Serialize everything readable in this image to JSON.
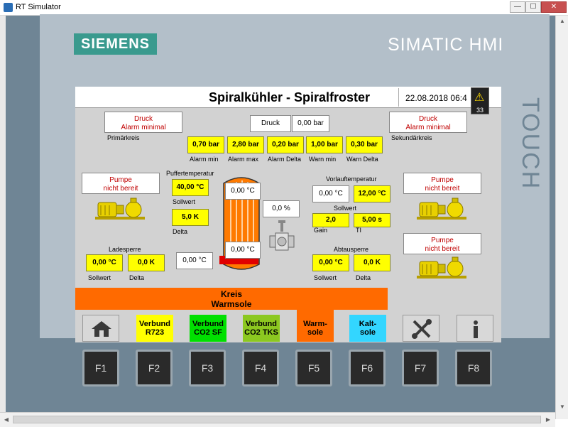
{
  "window": {
    "title": "RT Simulator",
    "min": "—",
    "max": "☐",
    "close": "✕"
  },
  "device": {
    "brand": "SIEMENS",
    "product": "SIMATIC HMI",
    "touch": "TOUCH"
  },
  "screen": {
    "title": "Spiralkühler - Spiralfroster",
    "datetime": "22.08.2018 06:4",
    "alarm_count": "33"
  },
  "pressure": {
    "druck_label": "Druck",
    "druck_value": "0,00 bar",
    "alarm_primary": [
      "Druck",
      "Alarm minimal"
    ],
    "alarm_primary_label": "Primärkreis",
    "alarm_secondary": [
      "Druck",
      "Alarm minimal"
    ],
    "alarm_secondary_label": "Sekundärkreis",
    "limits": [
      {
        "value": "0,70 bar",
        "label": "Alarm min"
      },
      {
        "value": "2,80 bar",
        "label": "Alarm max"
      },
      {
        "value": "0,20 bar",
        "label": "Alarm Delta"
      },
      {
        "value": "1,00 bar",
        "label": "Warn min"
      },
      {
        "value": "0,30 bar",
        "label": "Warn Delta"
      }
    ]
  },
  "pumps": {
    "left": [
      "Pumpe",
      "nicht bereit"
    ],
    "right1": [
      "Pumpe",
      "nicht bereit"
    ],
    "right2": [
      "Pumpe",
      "nicht bereit"
    ]
  },
  "buffer": {
    "title": "Puffertemperatur",
    "setpoint": "40,00 °C",
    "setpoint_label": "Sollwert",
    "delta": "5,0 K",
    "delta_label": "Delta"
  },
  "tank": {
    "top_temp": "0,00 °C",
    "bottom_temp": "0,00 °C",
    "side_temp": "0,00 °C"
  },
  "valve": {
    "position": "0,0 %"
  },
  "ladesperre": {
    "title": "Ladesperre",
    "setpoint": "0,00 °C",
    "setpoint_label": "Sollwert",
    "delta": "0,0 K",
    "delta_label": "Delta"
  },
  "vorlauf": {
    "title": "Vorlauftemperatur",
    "actual": "0,00 °C",
    "setpoint": "12,00 °C",
    "setpoint_label": "Sollwert",
    "gain": "2,0",
    "gain_label": "Gain",
    "ti": "5,00 s",
    "ti_label": "TI"
  },
  "abtausperre": {
    "title": "Abtausperre",
    "setpoint": "0,00 °C",
    "setpoint_label": "Sollwert",
    "delta": "0,0 K",
    "delta_label": "Delta"
  },
  "circuit": {
    "line1": "Kreis",
    "line2": "Warmsole"
  },
  "nav": [
    {
      "line1": "Verbund",
      "line2": "R723",
      "color": "#ffff00"
    },
    {
      "line1": "Verbund",
      "line2": "CO2 SF",
      "color": "#00e000"
    },
    {
      "line1": "Verbund",
      "line2": "CO2 TKS",
      "color": "#8cc820"
    },
    {
      "line1": "Warm-",
      "line2": "sole",
      "color": "#ff6a00"
    },
    {
      "line1": "Kalt-",
      "line2": "sole",
      "color": "#33d6ff"
    }
  ],
  "fkeys": [
    "F1",
    "F2",
    "F3",
    "F4",
    "F5",
    "F6",
    "F7",
    "F8"
  ],
  "colors": {
    "accent_orange": "#ff6a00",
    "value_yellow": "#ffff00",
    "alarm_red": "#c00000",
    "siemens_teal": "#3a9a8e"
  }
}
